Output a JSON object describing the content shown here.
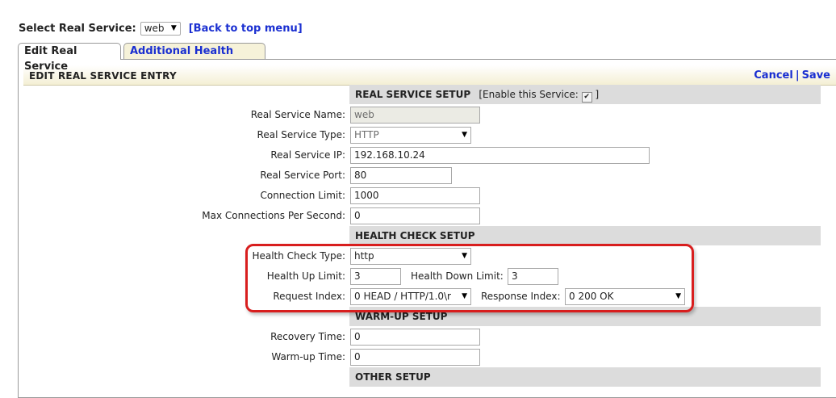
{
  "top": {
    "select_label": "Select Real Service:",
    "select_value": "web",
    "back_link": "[Back to top menu]"
  },
  "tabs": {
    "edit": "Edit Real Service",
    "health": "Additional Health Check"
  },
  "header": {
    "title": "EDIT REAL SERVICE ENTRY",
    "cancel": "Cancel",
    "separator": "|",
    "save": "Save"
  },
  "real_service_setup": {
    "title": "REAL SERVICE SETUP",
    "enable_open": "[Enable this Service:",
    "enable_close": "]",
    "enabled": true,
    "name_label": "Real Service Name:",
    "name_value": "web",
    "type_label": "Real Service Type:",
    "type_value": "HTTP",
    "ip_label": "Real Service IP:",
    "ip_value": "192.168.10.24",
    "port_label": "Real Service Port:",
    "port_value": "80",
    "conn_limit_label": "Connection Limit:",
    "conn_limit_value": "1000",
    "max_conn_label": "Max Connections Per Second:",
    "max_conn_value": "0"
  },
  "health_check_setup": {
    "title": "HEALTH CHECK SETUP",
    "type_label": "Health Check Type:",
    "type_value": "http",
    "up_label": "Health Up Limit:",
    "up_value": "3",
    "down_label": "Health Down Limit:",
    "down_value": "3",
    "request_label": "Request Index:",
    "request_value": "0 HEAD / HTTP/1.0\\r",
    "response_label": "Response Index:",
    "response_value": "0 200 OK"
  },
  "warmup_setup": {
    "title": "WARM-UP SETUP",
    "recovery_label": "Recovery Time:",
    "recovery_value": "0",
    "warmup_label": "Warm-up Time:",
    "warmup_value": "0"
  },
  "other_setup": {
    "title": "OTHER SETUP"
  },
  "colors": {
    "link": "#1a2fd1",
    "section_bg": "#dcdcdc",
    "highlight": "#d81e1e"
  }
}
